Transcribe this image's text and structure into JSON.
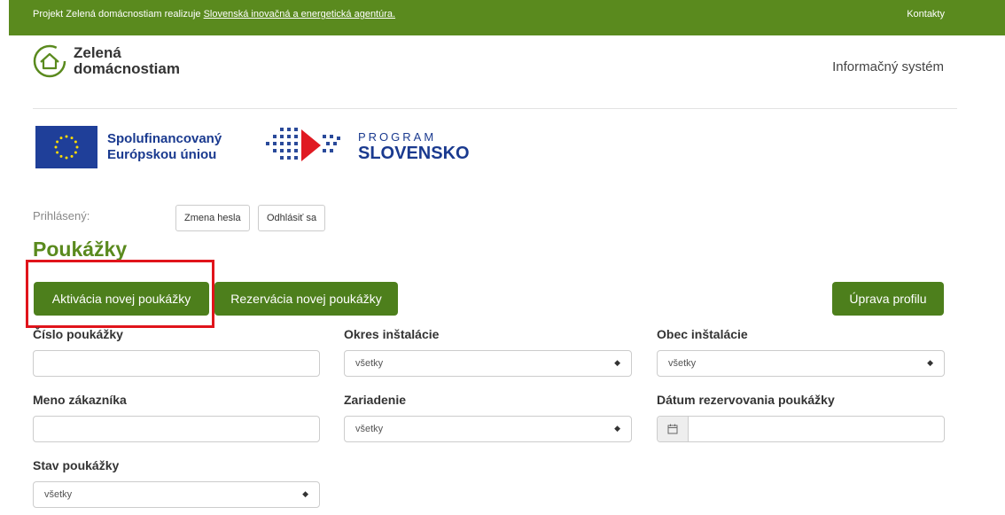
{
  "topbar": {
    "text": "Projekt Zelená domácnostiam realizuje ",
    "link": "Slovenská inovačná a energetická agentúra.",
    "contact": "Kontakty"
  },
  "logo": {
    "line1": "Zelená",
    "line2": "domácnostiam"
  },
  "header": {
    "infosys": "Informačný systém"
  },
  "eu": {
    "line1": "Spolufinancovaný",
    "line2": "Európskou úniou"
  },
  "program": {
    "top": "PROGRAM",
    "bottom": "SLOVENSKO"
  },
  "login": {
    "label": "Prihlásený:",
    "change_password": "Zmena hesla",
    "logout": "Odhlásiť sa"
  },
  "page": {
    "title": "Poukážky"
  },
  "actions": {
    "activate": "Aktivácia novej poukážky",
    "reserve": "Rezervácia novej poukážky",
    "profile": "Úprava profilu"
  },
  "filters": {
    "voucher_number": "Číslo poukážky",
    "district": "Okres inštalácie",
    "municipality": "Obec inštalácie",
    "customer_name": "Meno zákazníka",
    "device": "Zariadenie",
    "reservation_date": "Dátum rezervovania poukážky",
    "status": "Stav poukážky",
    "all": "všetky"
  },
  "colors": {
    "brand_green": "#5a8a1e",
    "button_green": "#4d7f1c",
    "highlight_red": "#e0141b",
    "eu_blue": "#1f3f99"
  },
  "icons": {
    "logo": "house-leaf-icon",
    "date": "calendar-icon",
    "select": "sort-arrows-icon"
  }
}
